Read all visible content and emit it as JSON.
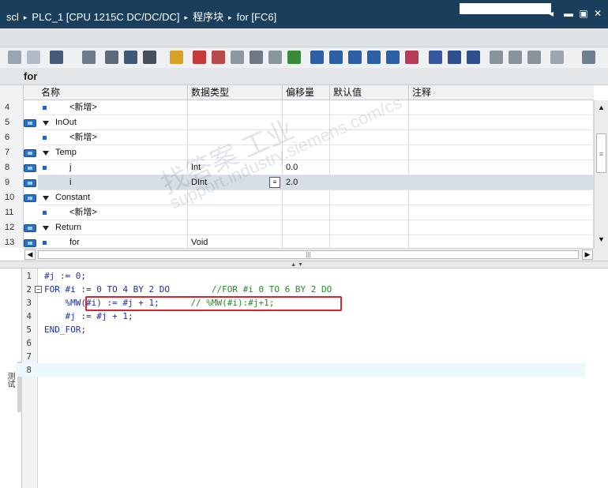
{
  "title_bar": {
    "crumbs": [
      "scl",
      "PLC_1 [CPU 1215C DC/DC/DC]",
      "程序块",
      "for [FC6]"
    ],
    "separator": "▸"
  },
  "block_name": "for",
  "interface_table": {
    "headers": [
      "名称",
      "数据类型",
      "偏移量",
      "默认值",
      "注释"
    ],
    "rows": [
      {
        "num": "4",
        "icon": false,
        "expand": false,
        "bullet": true,
        "name": "<新增>",
        "type": "",
        "offset": "",
        "indent": 2
      },
      {
        "num": "5",
        "icon": true,
        "expand": true,
        "bullet": false,
        "name": "InOut",
        "type": "",
        "offset": "",
        "indent": 1
      },
      {
        "num": "6",
        "icon": false,
        "expand": false,
        "bullet": true,
        "name": "<新增>",
        "type": "",
        "offset": "",
        "indent": 2
      },
      {
        "num": "7",
        "icon": true,
        "expand": true,
        "bullet": false,
        "name": "Temp",
        "type": "",
        "offset": "",
        "indent": 1
      },
      {
        "num": "8",
        "icon": true,
        "expand": false,
        "bullet": true,
        "name": "j",
        "type": "Int",
        "offset": "0.0",
        "indent": 2
      },
      {
        "num": "9",
        "icon": true,
        "expand": false,
        "bullet": true,
        "name": "i",
        "type": "DInt",
        "offset": "2.0",
        "indent": 2,
        "selected": true
      },
      {
        "num": "10",
        "icon": true,
        "expand": true,
        "bullet": false,
        "name": "Constant",
        "type": "",
        "offset": "",
        "indent": 1
      },
      {
        "num": "11",
        "icon": false,
        "expand": false,
        "bullet": true,
        "name": "<新增>",
        "type": "",
        "offset": "",
        "indent": 2
      },
      {
        "num": "12",
        "icon": true,
        "expand": true,
        "bullet": false,
        "name": "Return",
        "type": "",
        "offset": "",
        "indent": 1
      },
      {
        "num": "13",
        "icon": true,
        "expand": false,
        "bullet": true,
        "name": "for",
        "type": "Void",
        "offset": "",
        "indent": 2
      }
    ]
  },
  "code_editor": {
    "lines": [
      {
        "num": "1",
        "fold": "",
        "code": "#j := 0;",
        "comment": ""
      },
      {
        "num": "2",
        "fold": "−",
        "code": "FOR #i := 0 TO 4 BY 2 DO",
        "comment": "        //FOR #i 0 TO 6 BY 2 DO"
      },
      {
        "num": "3",
        "fold": "",
        "code": "    %MW(#i) := #j + 1;",
        "comment": "      // %MW(#i):#j+1;"
      },
      {
        "num": "4",
        "fold": "",
        "code": "    #j := #j + 1;",
        "comment": ""
      },
      {
        "num": "5",
        "fold": "",
        "code": "END_FOR;",
        "comment": ""
      },
      {
        "num": "6",
        "fold": "",
        "code": "",
        "comment": ""
      },
      {
        "num": "7",
        "fold": "",
        "code": "",
        "comment": ""
      },
      {
        "num": "8",
        "fold": "",
        "code": "",
        "comment": ""
      }
    ]
  },
  "side_panel_label": "测试",
  "watermark": {
    "text1": "找答案 工业",
    "text2": "support.industry.siemens.com/cs"
  },
  "colors": {
    "titlebar": "#1a3f5c",
    "keyword": "#1d2fa8",
    "comment": "#2a8a2a",
    "highlight_box": "#d8242e"
  }
}
